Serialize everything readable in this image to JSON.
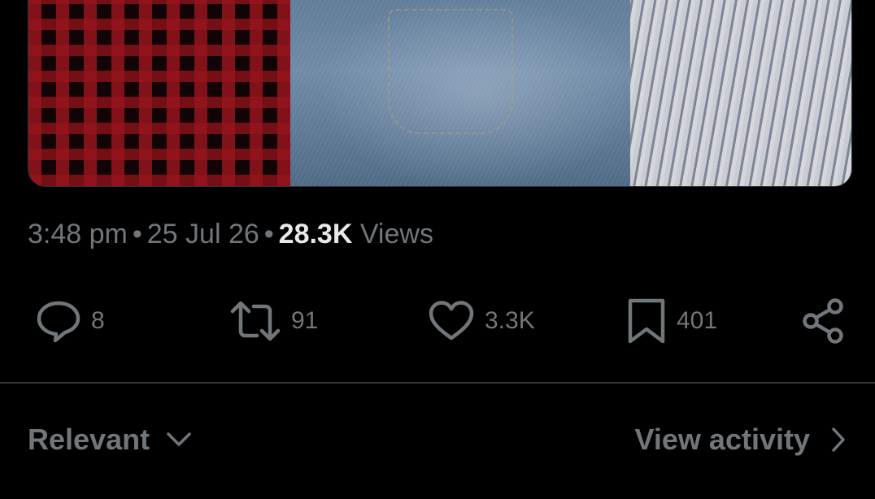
{
  "post": {
    "media_alt": "photo",
    "time": "3:48 pm",
    "date": "25 Jul 26",
    "separator": "•",
    "views_count": "28.3K",
    "views_label": "Views"
  },
  "actions": {
    "replies": {
      "icon": "reply-icon",
      "count": "8"
    },
    "reposts": {
      "icon": "repost-icon",
      "count": "91"
    },
    "likes": {
      "icon": "heart-icon",
      "count": "3.3K"
    },
    "bookmarks": {
      "icon": "bookmark-icon",
      "count": "401"
    },
    "share": {
      "icon": "share-icon"
    }
  },
  "replies_header": {
    "sort_label": "Relevant",
    "sort_icon": "chevron-down-icon",
    "activity_label": "View activity",
    "activity_icon": "chevron-right-icon"
  },
  "colors": {
    "background": "#000000",
    "muted_text": "#71767b",
    "primary_text": "#e7e9ea",
    "divider": "#2f3336"
  }
}
